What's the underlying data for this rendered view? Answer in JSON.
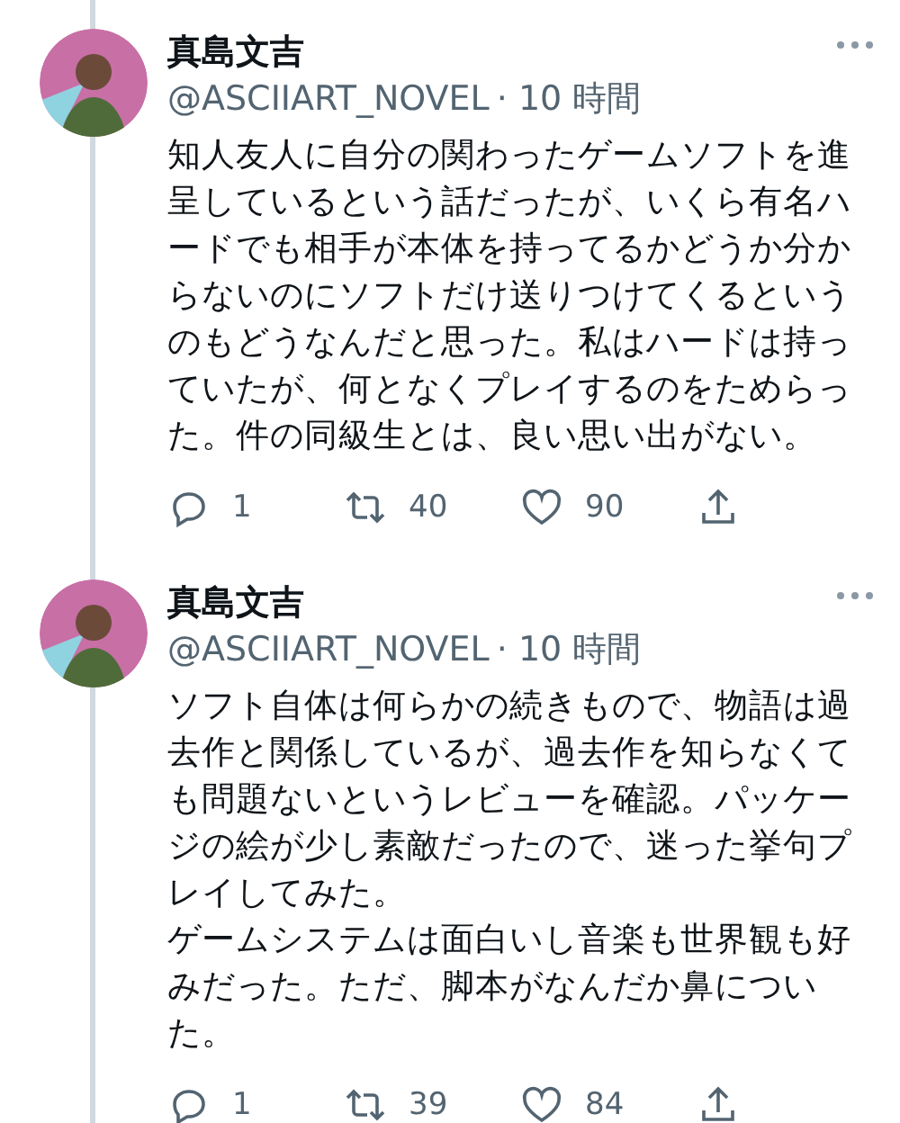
{
  "tweets": [
    {
      "name": "真島文吉",
      "handle": "@ASCIIART_NOVEL",
      "time": "· 10 時間",
      "body": [
        "知人友人に自分の関わったゲームソフトを進",
        "呈しているという話だったが、いくら有名ハ",
        "ードでも相手が本体を持ってるかどうか分か",
        "らないのにソフトだけ送りつけてくるという",
        "のもどうなんだと思った。私はハードは持っ",
        "ていたが、何となくプレイするのをためらっ",
        "た。件の同級生とは、良い思い出がない。"
      ],
      "replies": "1",
      "retweets": "40",
      "likes": "90"
    },
    {
      "name": "真島文吉",
      "handle": "@ASCIIART_NOVEL",
      "time": "· 10 時間",
      "body": [
        "ソフト自体は何らかの続きもので、物語は過",
        "去作と関係しているが、過去作を知らなくて",
        "も問題ないというレビューを確認。パッケー",
        "ジの絵が少し素敵だったので、迷った挙句プ",
        "レイしてみた。",
        "ゲームシステムは面白いし音楽も世界観も好",
        "みだった。ただ、脚本がなんだか鼻につい",
        "た。"
      ],
      "replies": "1",
      "retweets": "39",
      "likes": "84"
    }
  ]
}
